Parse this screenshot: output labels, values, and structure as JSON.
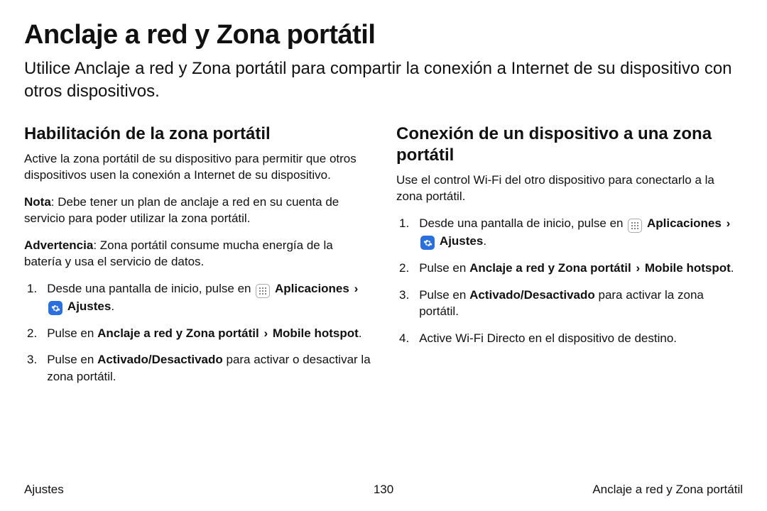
{
  "title": "Anclaje a red y Zona portátil",
  "intro": "Utilice Anclaje a red y Zona portátil para compartir la conexión a Internet de su dispositivo con otros dispositivos.",
  "left": {
    "heading": "Habilitación de la zona portátil",
    "p1": "Active la zona portátil de su dispositivo para permitir que otros dispositivos usen la conexión a Internet de su dispositivo.",
    "note_label": "Nota",
    "note_text": ": Debe tener un plan de anclaje a red en su cuenta de servicio para poder utilizar la zona portátil.",
    "warn_label": "Advertencia",
    "warn_text": ": Zona portátil consume mucha energía de la batería y usa el servicio de datos.",
    "s1_pre": "Desde una pantalla de inicio, pulse en ",
    "apps": "Aplicaciones",
    "ajustes": "Ajustes",
    "s2_pre": "Pulse en ",
    "s2_b1": "Anclaje a red y Zona portátil",
    "s2_b2": "Mobile hotspot",
    "s3_pre": "Pulse en ",
    "s3_b": "Activado/Desactivado",
    "s3_post": " para activar o desactivar la zona portátil."
  },
  "right": {
    "heading": "Conexión de un dispositivo a una zona portátil",
    "p1": "Use el control Wi-Fi del otro dispositivo para conectarlo a la zona portátil.",
    "s1_pre": "Desde una pantalla de inicio, pulse en ",
    "apps": "Aplicaciones",
    "ajustes": "Ajustes",
    "s2_pre": "Pulse en ",
    "s2_b1": "Anclaje a red y Zona portátil",
    "s2_b2": "Mobile hotspot",
    "s3_pre": "Pulse en ",
    "s3_b": "Activado/Desactivado",
    "s3_post": " para activar la zona portátil.",
    "s4": "Active Wi-Fi Directo en el dispositivo de destino."
  },
  "footer": {
    "left": "Ajustes",
    "center": "130",
    "right": "Anclaje a red y Zona portátil"
  },
  "icons": {
    "chev": "›"
  }
}
